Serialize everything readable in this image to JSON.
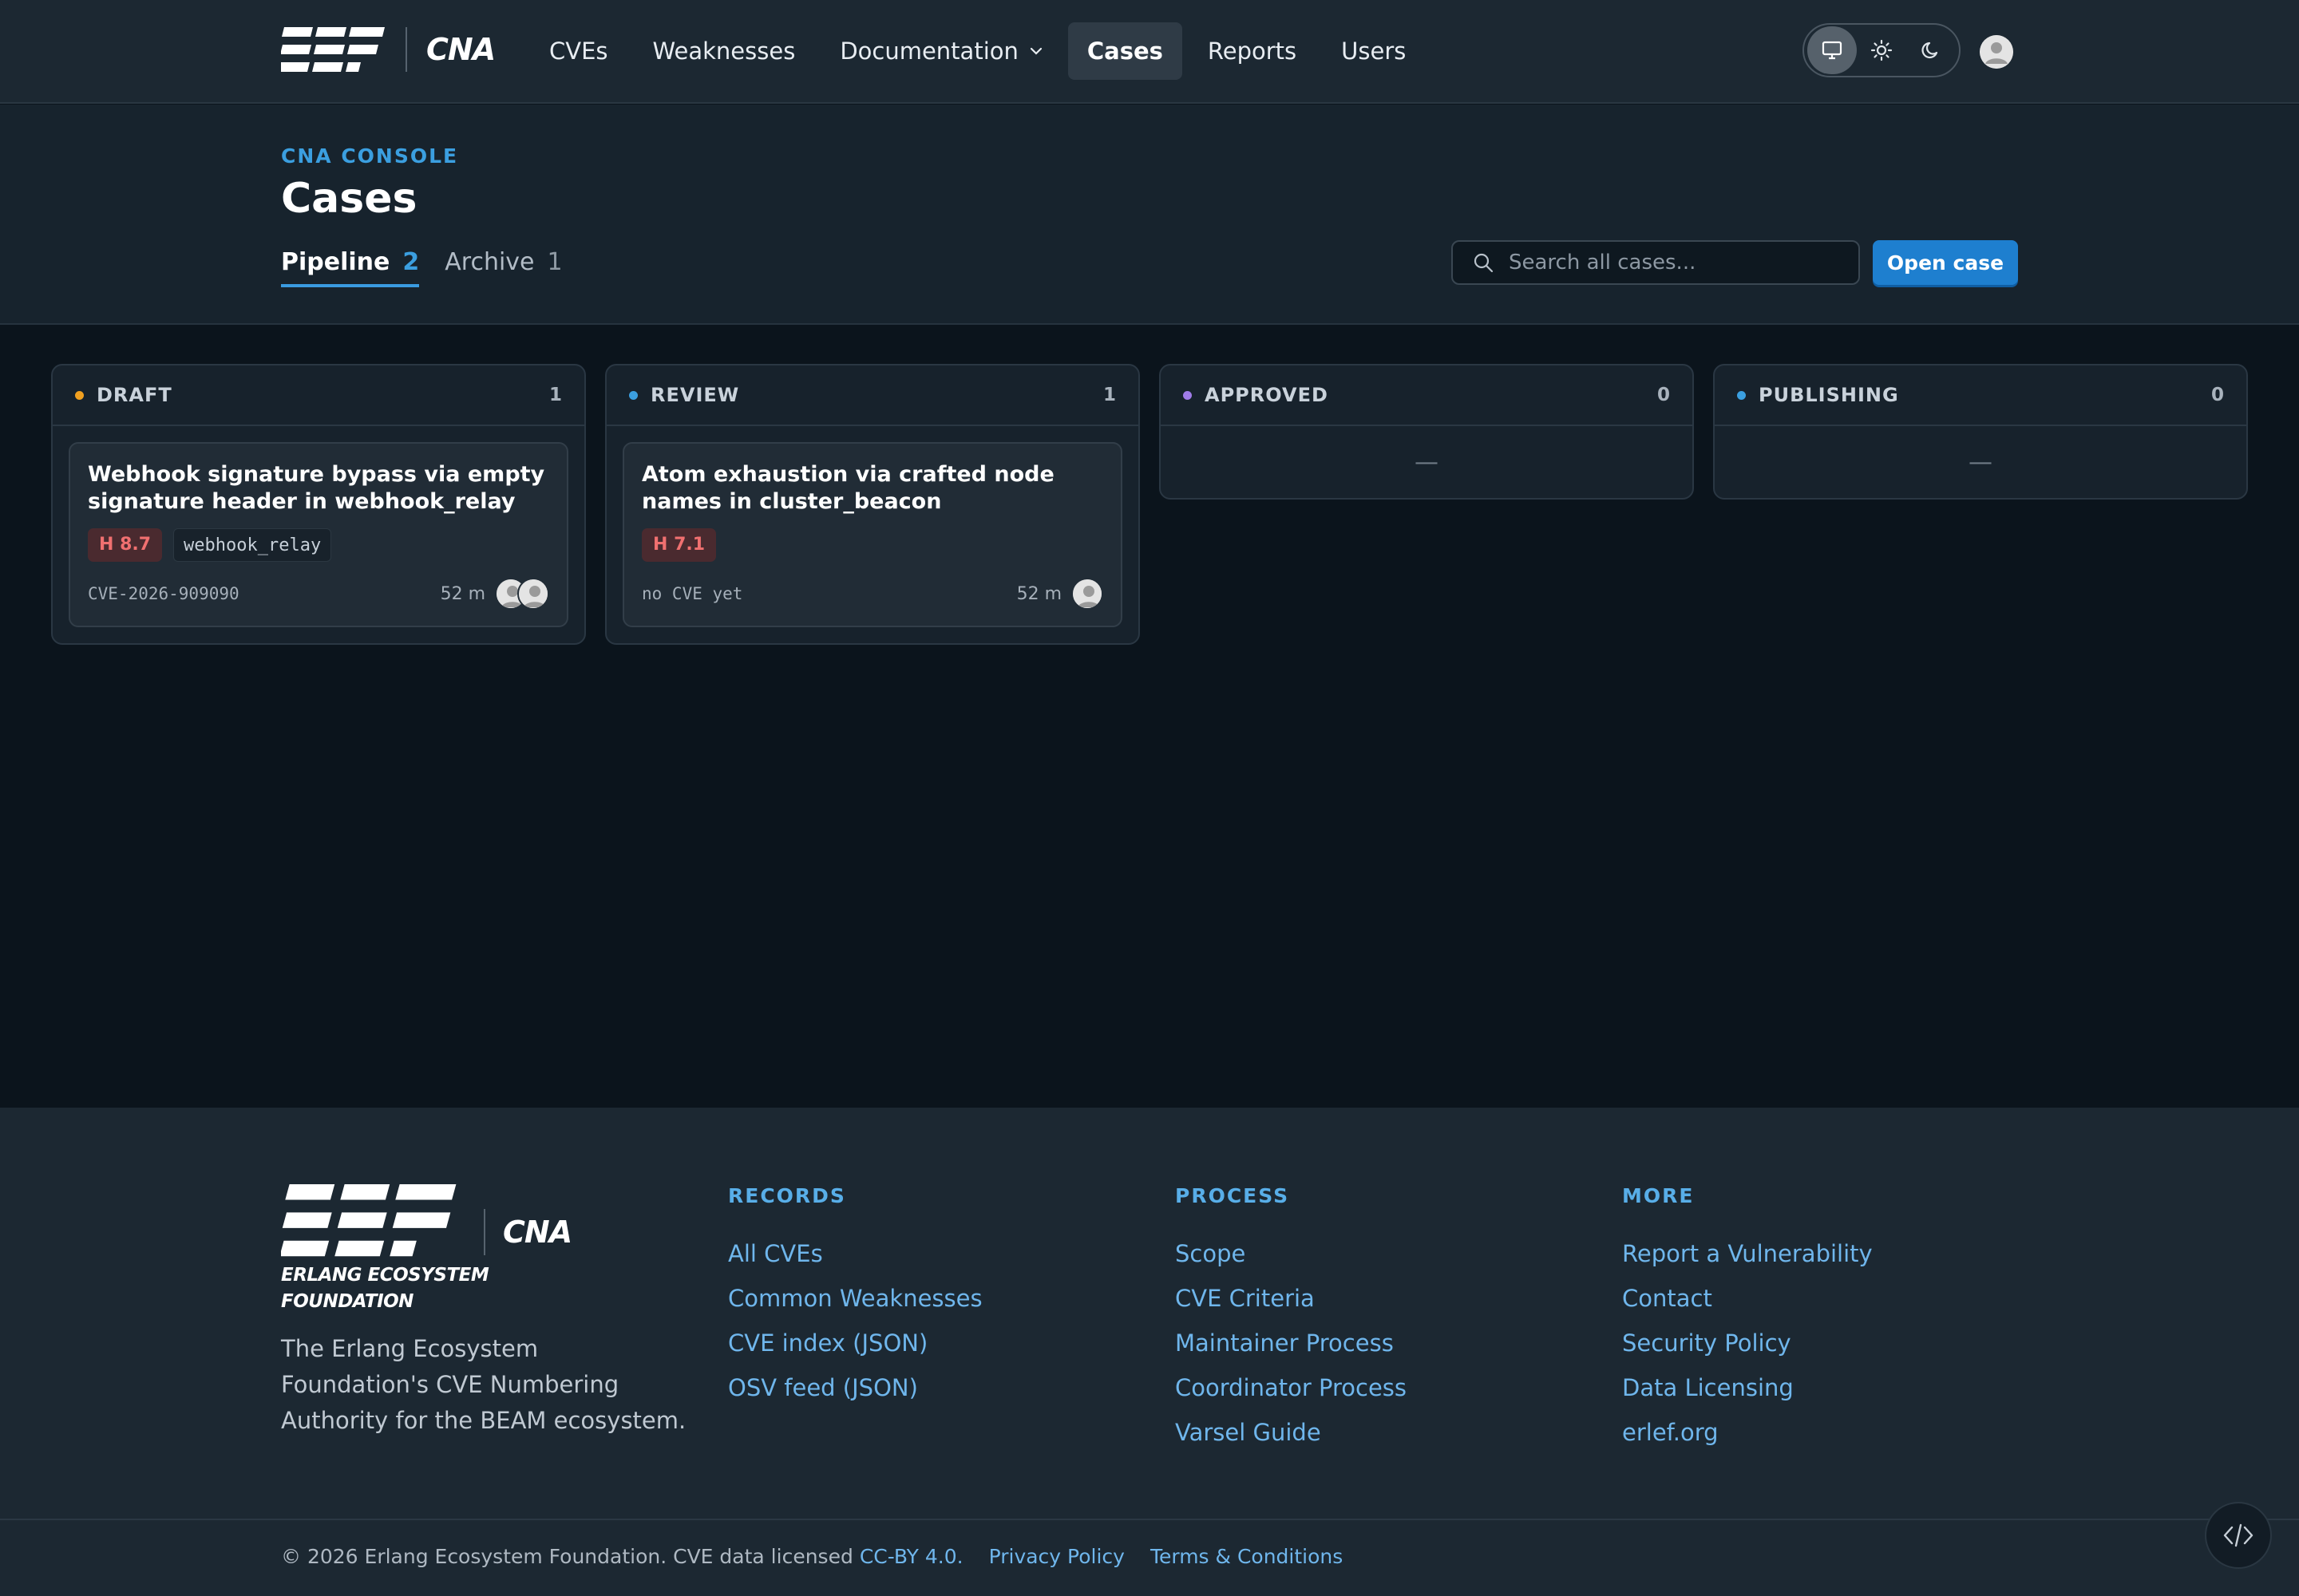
{
  "brand": {
    "cna_label": "CNA",
    "foundation_line1": "ERLANG ECOSYSTEM",
    "foundation_line2": "FOUNDATION"
  },
  "nav": {
    "items": [
      {
        "label": "CVEs"
      },
      {
        "label": "Weaknesses"
      },
      {
        "label": "Documentation"
      },
      {
        "label": "Cases",
        "active": true
      },
      {
        "label": "Reports"
      },
      {
        "label": "Users"
      }
    ],
    "theme_modes": [
      "system-icon",
      "sun-icon",
      "moon-icon"
    ],
    "active_theme": "system"
  },
  "header": {
    "eyebrow": "CNA CONSOLE",
    "title": "Cases",
    "tabs": [
      {
        "label": "Pipeline",
        "count": "2",
        "active": true
      },
      {
        "label": "Archive",
        "count": "1"
      }
    ],
    "search_placeholder": "Search all cases...",
    "open_button": "Open case"
  },
  "board": {
    "columns": [
      {
        "title": "DRAFT",
        "count": "1",
        "dot_color": "#f0a020",
        "cards": [
          {
            "title": "Webhook signature bypass via empty signature header in webhook_relay",
            "severity": "H 8.7",
            "package": "webhook_relay",
            "cve": "CVE-2026-909090",
            "age": "52 m",
            "assignees": 2
          }
        ]
      },
      {
        "title": "REVIEW",
        "count": "1",
        "dot_color": "#3b9fe0",
        "cards": [
          {
            "title": "Atom exhaustion via crafted node names in cluster_beacon",
            "severity": "H 7.1",
            "package": "",
            "cve": "no CVE yet",
            "age": "52 m",
            "assignees": 1
          }
        ]
      },
      {
        "title": "APPROVED",
        "count": "0",
        "dot_color": "#a07ce8",
        "empty": "—"
      },
      {
        "title": "PUBLISHING",
        "count": "0",
        "dot_color": "#3b9fe0",
        "empty": "—"
      }
    ]
  },
  "footer": {
    "tagline": "The Erlang Ecosystem Foundation's CVE Numbering Authority for the BEAM ecosystem.",
    "columns": [
      {
        "heading": "RECORDS",
        "links": [
          "All CVEs",
          "Common Weaknesses",
          "CVE index (JSON)",
          "OSV feed (JSON)"
        ]
      },
      {
        "heading": "PROCESS",
        "links": [
          "Scope",
          "CVE Criteria",
          "Maintainer Process",
          "Coordinator Process",
          "Varsel Guide"
        ]
      },
      {
        "heading": "MORE",
        "links": [
          "Report a Vulnerability",
          "Contact",
          "Security Policy",
          "Data Licensing",
          "erlef.org"
        ]
      }
    ],
    "copyright": "© 2026 Erlang Ecosystem Foundation. CVE data licensed",
    "license_link": "CC-BY 4.0.",
    "privacy": "Privacy Policy",
    "terms": "Terms & Conditions"
  },
  "colors": {
    "accent": "#1e7fcf",
    "link": "#6fb6ec",
    "severity_high": "#f07070"
  }
}
